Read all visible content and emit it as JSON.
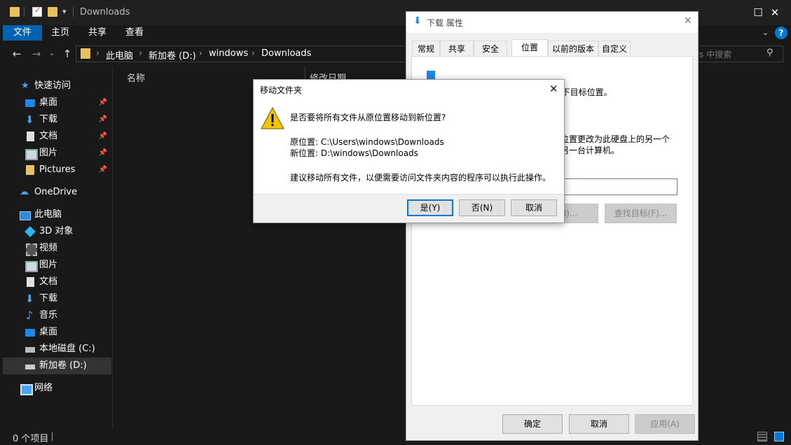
{
  "explorer": {
    "title": "Downloads",
    "ribbon_tabs": [
      "文件",
      "主页",
      "共享",
      "查看"
    ],
    "breadcrumb": [
      "此电脑",
      "新加卷 (D:)",
      "windows",
      "Downloads"
    ],
    "search_placeholder": "s 中搜索",
    "columns": {
      "name": "名称",
      "date": "修改日期"
    },
    "nav": {
      "quick_access": "快速访问",
      "quick_items": [
        "桌面",
        "下载",
        "文档",
        "图片",
        "Pictures"
      ],
      "onedrive": "OneDrive",
      "this_pc": "此电脑",
      "pc_items": [
        "3D 对象",
        "视频",
        "图片",
        "文档",
        "下载",
        "音乐",
        "桌面",
        "本地磁盘 (C:)",
        "新加卷 (D:)"
      ],
      "network": "网络"
    },
    "status": "0 个项目",
    "help": "?"
  },
  "props": {
    "title": "下载 属性",
    "tabs": [
      "常规",
      "共享",
      "安全",
      "位置",
      "以前的版本",
      "自定义"
    ],
    "line1": "文件夹 下载 中的文件存储于以下目标位置。",
    "line2": "位置更改为此硬盘上的另一个",
    "line3": "另一台计算机。",
    "move_btn_partial": "M)...",
    "find_target": "查找目标(F)...",
    "ok": "确定",
    "cancel": "取消",
    "apply": "应用(A)"
  },
  "move_dialog": {
    "title": "移动文件夹",
    "question": "是否要将所有文件从原位置移动到新位置?",
    "orig_label": "原位置: C:\\Users\\windows\\Downloads",
    "new_label": "新位置: D:\\windows\\Downloads",
    "advice": "建议移动所有文件，以便需要访问文件夹内容的程序可以执行此操作。",
    "yes": "是(Y)",
    "no": "否(N)",
    "cancel": "取消"
  },
  "colors": {
    "accent": "#0063b1",
    "warning": "#f5c400",
    "dark_bg": "#191919"
  }
}
